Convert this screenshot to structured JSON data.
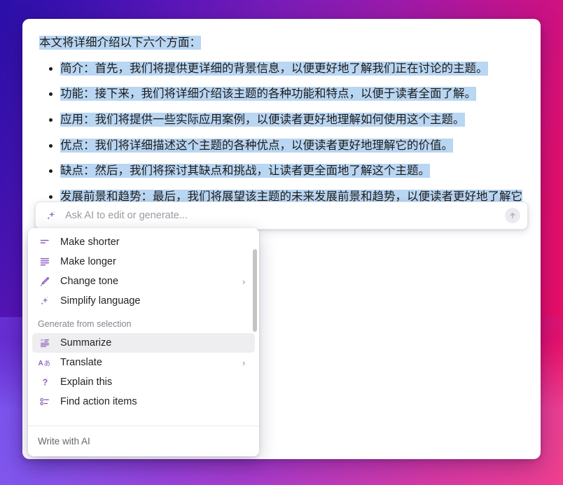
{
  "background": {
    "gradient_from": "#2a0fa8",
    "gradient_mid": "#9b1bab",
    "gradient_to": "#ee0d63",
    "bottom_from": "#7b5cf0",
    "bottom_to": "#ee3f8f"
  },
  "document": {
    "selection_color": "#b9d6f2",
    "lead_paragraph": "本文将详细介绍以下六个方面：",
    "bullets": [
      "简介：首先，我们将提供更详细的背景信息，以便更好地了解我们正在讨论的主题。",
      "功能：接下来，我们将详细介绍该主题的各种功能和特点，以便于读者全面了解。",
      "应用：我们将提供一些实际应用案例，以便读者更好地理解如何使用这个主题。",
      "优点：我们将详细描述这个主题的各种优点，以便读者更好地理解它的价值。",
      "缺点：然后，我们将探讨其缺点和挑战，让读者更全面地了解这个主题。",
      "发展前景和趋势：最后，我们将展望该主题的未来发展前景和趋势，以便读者更好地了解它的重要性和未来价值。"
    ]
  },
  "ai_bar": {
    "icon": "sparkle-icon",
    "placeholder": "Ask AI to edit or generate...",
    "value": "",
    "submit_icon": "arrow-up-icon"
  },
  "ai_menu": {
    "accent_color": "#8b5fbf",
    "highlight_color": "#eeedf0",
    "items": [
      {
        "label": "Make shorter",
        "icon": "make-shorter-icon",
        "submenu": false,
        "active": false
      },
      {
        "label": "Make longer",
        "icon": "make-longer-icon",
        "submenu": false,
        "active": false
      },
      {
        "label": "Change tone",
        "icon": "pen-icon",
        "submenu": true,
        "active": false
      },
      {
        "label": "Simplify language",
        "icon": "sparkle-icon",
        "submenu": false,
        "active": false
      }
    ],
    "section_label": "Generate from selection",
    "generate_items": [
      {
        "label": "Summarize",
        "icon": "quote-lines-icon",
        "submenu": false,
        "active": true
      },
      {
        "label": "Translate",
        "icon": "translate-icon",
        "submenu": true,
        "active": false
      },
      {
        "label": "Explain this",
        "icon": "question-mark-icon",
        "submenu": false,
        "active": false
      },
      {
        "label": "Find action items",
        "icon": "checklist-icon",
        "submenu": false,
        "active": false
      }
    ],
    "footer_label": "Write with AI",
    "submenu_chevron": "›"
  }
}
